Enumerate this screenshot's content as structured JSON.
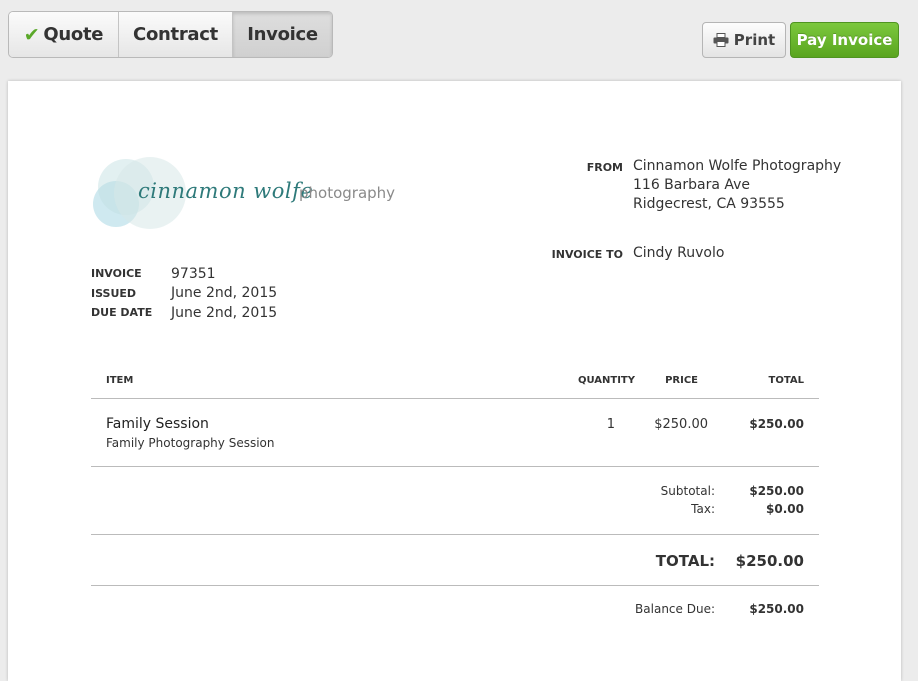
{
  "tabs": [
    {
      "label": "Quote",
      "checked": true
    },
    {
      "label": "Contract"
    },
    {
      "label": "Invoice",
      "active": true
    }
  ],
  "actions": {
    "print_label": "Print",
    "pay_label": "Pay Invoice"
  },
  "logo": {
    "script": "cinnamon wolfe",
    "word": "photography"
  },
  "from": {
    "label": "FROM",
    "lines": [
      "Cinnamon Wolfe Photography",
      "116 Barbara Ave",
      "Ridgecrest, CA 93555"
    ]
  },
  "invoice_to": {
    "label": "INVOICE TO",
    "name": "Cindy Ruvolo"
  },
  "meta": {
    "invoice_label": "INVOICE",
    "invoice_value": "97351",
    "issued_label": "ISSUED",
    "issued_value": "June 2nd, 2015",
    "due_label": "DUE DATE",
    "due_value": "June 2nd, 2015"
  },
  "table": {
    "headers": {
      "item": "ITEM",
      "quantity": "QUANTITY",
      "price": "PRICE",
      "total": "TOTAL"
    },
    "rows": [
      {
        "name": "Family Session",
        "description": "Family Photography Session",
        "quantity": "1",
        "price": "$250.00",
        "total": "$250.00"
      }
    ]
  },
  "summary": {
    "subtotal_label": "Subtotal:",
    "subtotal_value": "$250.00",
    "tax_label": "Tax:",
    "tax_value": "$0.00",
    "total_label": "TOTAL:",
    "total_value": "$250.00",
    "balance_label": "Balance Due:",
    "balance_value": "$250.00"
  },
  "colors": {
    "pay_green": "#6cb82f",
    "logo_teal": "#2e7a7a",
    "check_green": "#5aa829"
  }
}
